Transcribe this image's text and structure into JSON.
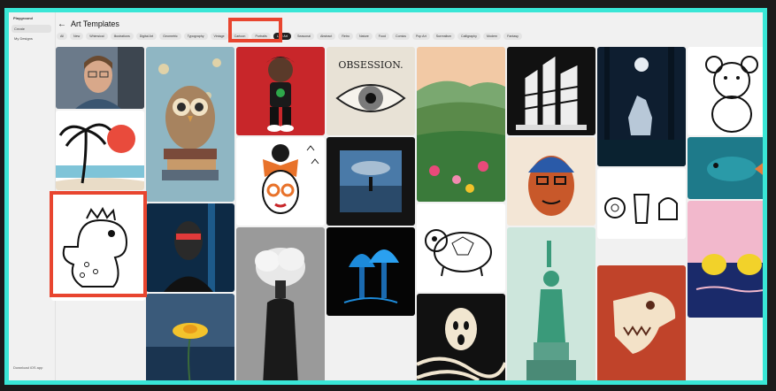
{
  "sidebar": {
    "brand": "Playground",
    "items": [
      {
        "label": "Create",
        "active": true
      },
      {
        "label": "My Designs",
        "active": false
      }
    ],
    "footer": "Download iOS app"
  },
  "header": {
    "back_icon": "arrow-left-icon",
    "title": "Art Templates"
  },
  "filters": [
    {
      "label": "All",
      "selected": false
    },
    {
      "label": "New",
      "selected": false
    },
    {
      "label": "Whimsical",
      "selected": false
    },
    {
      "label": "Illustrations",
      "selected": false
    },
    {
      "label": "Digital Art",
      "selected": false
    },
    {
      "label": "Geometric",
      "selected": false
    },
    {
      "label": "Typography",
      "selected": false
    },
    {
      "label": "Vintage",
      "selected": false
    },
    {
      "label": "Cartoon",
      "selected": false
    },
    {
      "label": "Portraits",
      "selected": false
    },
    {
      "label": "Line Art",
      "selected": true
    },
    {
      "label": "Seasonal",
      "selected": false
    },
    {
      "label": "Abstract",
      "selected": false
    },
    {
      "label": "Retro",
      "selected": false
    },
    {
      "label": "Nature",
      "selected": false
    },
    {
      "label": "Food",
      "selected": false
    },
    {
      "label": "Comics",
      "selected": false
    },
    {
      "label": "Pop Art",
      "selected": false
    },
    {
      "label": "Surrealism",
      "selected": false
    },
    {
      "label": "Calligraphy",
      "selected": false
    },
    {
      "label": "Modern",
      "selected": false
    },
    {
      "label": "Fantasy",
      "selected": false
    }
  ],
  "gallery": {
    "obsession_text": "OBSESSION."
  },
  "colors": {
    "accent_border": "#39e6d6",
    "highlight": "#e8452f"
  }
}
